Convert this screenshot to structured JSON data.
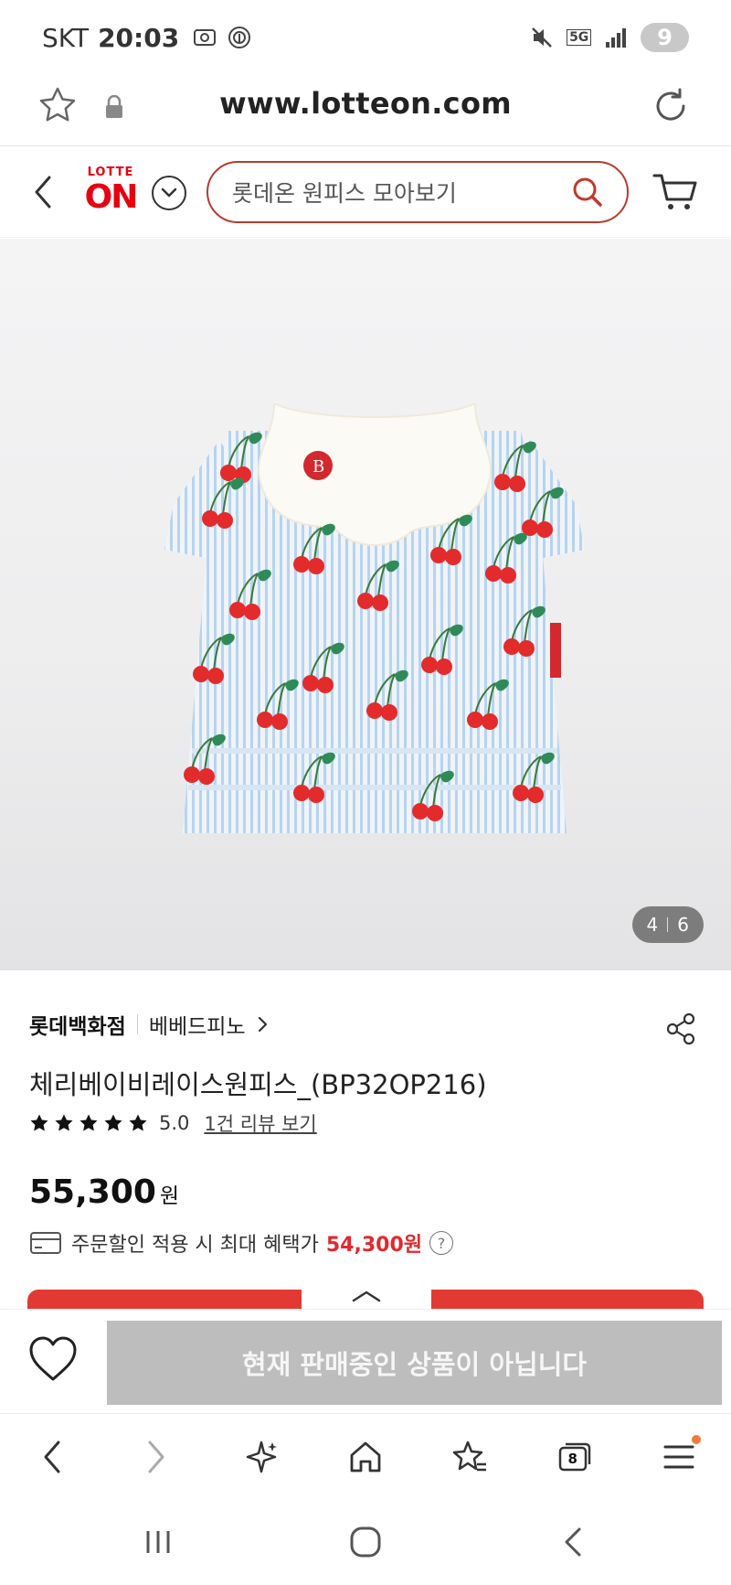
{
  "status_bar": {
    "carrier": "SKT",
    "time": "20:03",
    "network": "5G",
    "battery_badge": "9"
  },
  "browser": {
    "url": "www.lotteon.com",
    "tab_count": "8"
  },
  "site_header": {
    "logo_top": "LOTTE",
    "logo_main": "ON",
    "search_placeholder": "롯데온 원피스 모아보기"
  },
  "gallery": {
    "current": "4",
    "total": "6"
  },
  "product": {
    "store": "롯데백화점",
    "brand": "베베드피노",
    "title": "체리베이비레이스원피스_(BP32OP216)",
    "rating": "5.0",
    "rating_value": 5,
    "review_link": "1건 리뷰 보기",
    "price": "55,300",
    "price_unit": "원",
    "benefit_text": "주문할인 적용 시 최대 혜택가",
    "benefit_price": "54,300원"
  },
  "purchase": {
    "status_label": "현재 판매중인 상품이 아닙니다"
  },
  "colors": {
    "brand_red": "#e60012",
    "search_border": "#b43c2c",
    "benefit_red": "#e0292e",
    "disabled_button": "#bdbdbd"
  }
}
